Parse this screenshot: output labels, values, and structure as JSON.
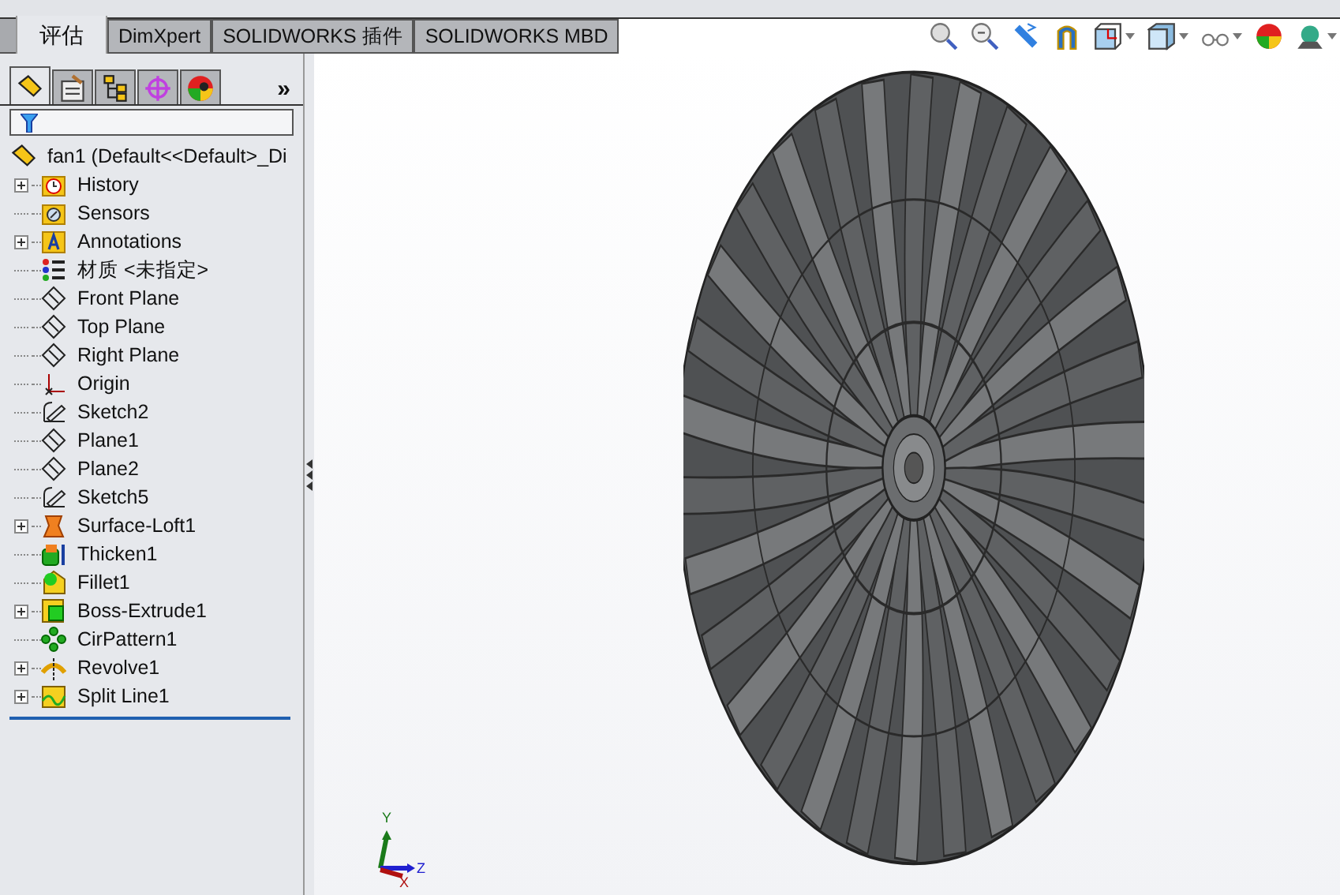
{
  "tabs": [
    {
      "label": "评估",
      "selected": true
    },
    {
      "label": "DimXpert",
      "selected": false
    },
    {
      "label": "SOLIDWORKS 插件",
      "selected": false
    },
    {
      "label": "SOLIDWORKS MBD",
      "selected": false
    }
  ],
  "panel_tabs": [
    {
      "kind": "feature",
      "selected": true
    },
    {
      "kind": "property",
      "selected": false
    },
    {
      "kind": "config",
      "selected": false
    },
    {
      "kind": "dimxpert",
      "selected": false
    },
    {
      "kind": "display",
      "selected": false
    }
  ],
  "more": "»",
  "tree": {
    "root": "fan1  (Default<<Default>_Di",
    "items": [
      {
        "label": "History",
        "kind": "history",
        "expandable": true
      },
      {
        "label": "Sensors",
        "kind": "sensors",
        "expandable": false
      },
      {
        "label": "Annotations",
        "kind": "annotations",
        "expandable": true
      },
      {
        "label": "材质 <未指定>",
        "kind": "material",
        "expandable": false
      },
      {
        "label": "Front Plane",
        "kind": "plane",
        "expandable": false
      },
      {
        "label": "Top Plane",
        "kind": "plane",
        "expandable": false
      },
      {
        "label": "Right Plane",
        "kind": "plane",
        "expandable": false
      },
      {
        "label": "Origin",
        "kind": "origin",
        "expandable": false
      },
      {
        "label": "Sketch2",
        "kind": "sketch",
        "expandable": false
      },
      {
        "label": "Plane1",
        "kind": "plane",
        "expandable": false
      },
      {
        "label": "Plane2",
        "kind": "plane",
        "expandable": false
      },
      {
        "label": "Sketch5",
        "kind": "sketch",
        "expandable": false
      },
      {
        "label": "Surface-Loft1",
        "kind": "loft",
        "expandable": true
      },
      {
        "label": "Thicken1",
        "kind": "thicken",
        "expandable": false
      },
      {
        "label": "Fillet1",
        "kind": "fillet",
        "expandable": false
      },
      {
        "label": "Boss-Extrude1",
        "kind": "extrude",
        "expandable": true
      },
      {
        "label": "CirPattern1",
        "kind": "pattern",
        "expandable": false
      },
      {
        "label": "Revolve1",
        "kind": "revolve",
        "expandable": true
      },
      {
        "label": "Split Line1",
        "kind": "split",
        "expandable": true
      }
    ]
  },
  "triad": {
    "y": "Y",
    "z": "Z",
    "x": "X"
  }
}
